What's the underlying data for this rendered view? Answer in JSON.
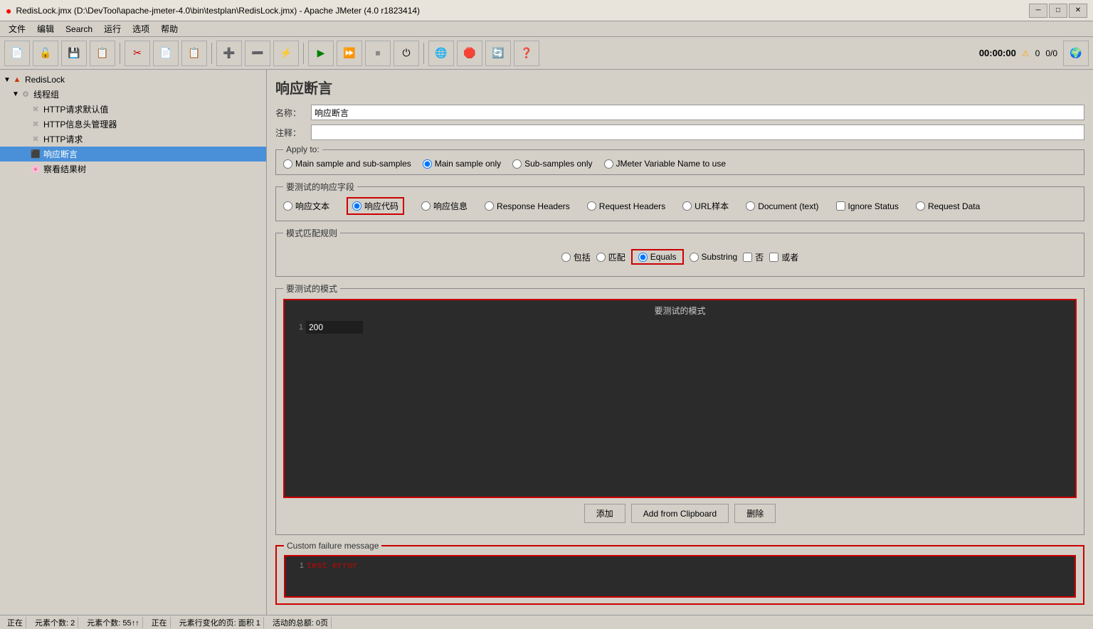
{
  "window": {
    "title": "RedisLock.jmx (D:\\DevTool\\apache-jmeter-4.0\\bin\\testplan\\RedisLock.jmx) - Apache JMeter (4.0 r1823414)",
    "title_icon": "🔴"
  },
  "menu": {
    "items": [
      "文件",
      "编辑",
      "Search",
      "运行",
      "选项",
      "帮助"
    ]
  },
  "toolbar": {
    "timer": "00:00:00",
    "warn_count": "0",
    "error_count": "0/0"
  },
  "sidebar": {
    "items": [
      {
        "id": "redislock",
        "label": "RedisLock",
        "level": 0,
        "type": "root",
        "icon": "▲",
        "expanded": true
      },
      {
        "id": "thread-group",
        "label": "线程组",
        "level": 1,
        "type": "gear",
        "icon": "⚙",
        "expanded": true
      },
      {
        "id": "http-defaults",
        "label": "HTTP请求默认值",
        "level": 2,
        "type": "cross",
        "icon": "✖"
      },
      {
        "id": "http-header",
        "label": "HTTP信息头管理器",
        "level": 2,
        "type": "cross",
        "icon": "✖"
      },
      {
        "id": "http-request",
        "label": "HTTP请求",
        "level": 2,
        "type": "cross",
        "icon": "✖"
      },
      {
        "id": "assert",
        "label": "响应断言",
        "level": 2,
        "type": "assert",
        "icon": "⬛",
        "selected": true
      },
      {
        "id": "result-tree",
        "label": "察看结果树",
        "level": 2,
        "type": "chart",
        "icon": "📊"
      }
    ]
  },
  "content": {
    "title": "响应断言",
    "name_label": "名称：",
    "name_value": "响应断言",
    "comment_label": "注释：",
    "comment_value": "",
    "apply_to": {
      "legend": "Apply to:",
      "options": [
        {
          "id": "main-sub",
          "label": "Main sample and sub-samples",
          "checked": false
        },
        {
          "id": "main-only",
          "label": "Main sample only",
          "checked": true
        },
        {
          "id": "sub-only",
          "label": "Sub-samples only",
          "checked": false
        },
        {
          "id": "jmeter-var",
          "label": "JMeter Variable Name to use",
          "checked": false
        }
      ]
    },
    "response_field": {
      "legend": "要测试的响应字段",
      "options": [
        {
          "id": "resp-text",
          "label": "响应文本",
          "checked": false
        },
        {
          "id": "resp-code",
          "label": "响应代码",
          "checked": true,
          "highlighted": true
        },
        {
          "id": "resp-msg",
          "label": "响应信息",
          "checked": false
        },
        {
          "id": "resp-headers",
          "label": "Response Headers",
          "checked": false
        },
        {
          "id": "req-headers",
          "label": "Request Headers",
          "checked": false
        },
        {
          "id": "url-sample",
          "label": "URL样本",
          "checked": false
        },
        {
          "id": "document",
          "label": "Document (text)",
          "checked": false
        },
        {
          "id": "ignore-status",
          "label": "Ignore Status",
          "checked": false
        },
        {
          "id": "req-data",
          "label": "Request Data",
          "checked": false
        }
      ]
    },
    "pattern_rule": {
      "legend": "模式匹配规则",
      "options": [
        {
          "id": "contains",
          "label": "包括",
          "checked": false
        },
        {
          "id": "matches",
          "label": "匹配",
          "checked": false
        },
        {
          "id": "equals",
          "label": "Equals",
          "checked": true,
          "active": true
        },
        {
          "id": "substring",
          "label": "Substring",
          "checked": false
        },
        {
          "id": "negate",
          "label": "否",
          "checked": false
        },
        {
          "id": "or",
          "label": "或者",
          "checked": false
        }
      ]
    },
    "test_patterns": {
      "legend": "要测试的模式",
      "header": "要测试的模式",
      "rows": [
        {
          "line": 1,
          "value": "200"
        }
      ]
    },
    "buttons": {
      "add": "添加",
      "add_clipboard": "Add from Clipboard",
      "delete": "删除"
    },
    "custom_failure": {
      "legend": "Custom failure message",
      "rows": [
        {
          "line": 1,
          "value": "test error"
        }
      ]
    }
  },
  "status_bar": {
    "segments": [
      "正在",
      "元素个数: 2",
      "元素个数: 55↑↑",
      "正在",
      "元素行变化的页: 面积 1",
      "活动的总额: 0页"
    ]
  },
  "edge_tabs": [
    "►",
    "►",
    "►",
    "►",
    "►"
  ]
}
